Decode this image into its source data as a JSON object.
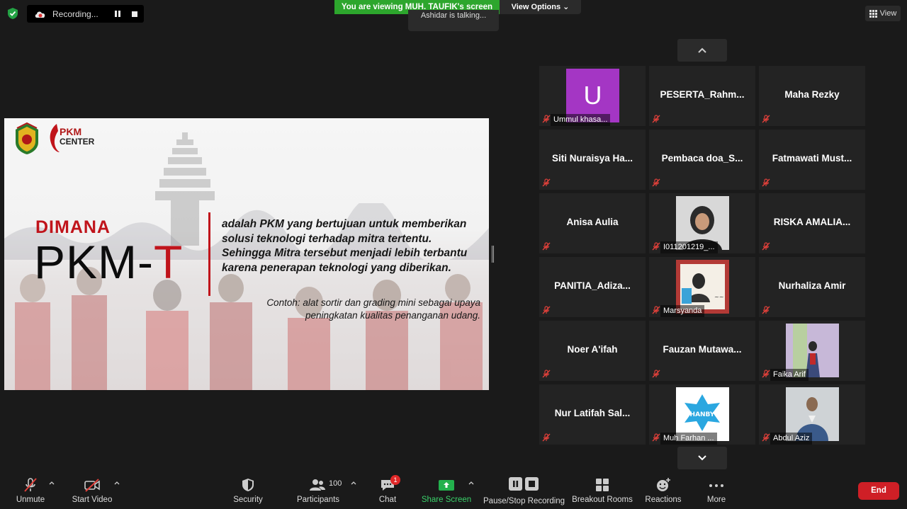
{
  "top": {
    "recording_label": "Recording...",
    "viewing_banner": "You are viewing MUH. TAUFIK's screen",
    "talking_indicator": "Ashidar is talking...",
    "view_options": "View Options",
    "view_button": "View"
  },
  "slide": {
    "dimana": "DIMANA",
    "pkm_t_main": "PKM-",
    "pkm_t_red": "T",
    "description": "adalah PKM yang bertujuan untuk memberikan solusi teknologi terhadap mitra tertentu. Sehingga Mitra tersebut menjadi lebih terbantu karena penerapan teknologi yang diberikan.",
    "example": "Contoh: alat sortir dan grading mini sebagai upaya peningkatan kualitas penanganan udang.",
    "logo_pkm_line1": "PKM",
    "logo_pkm_line2": "CENTER"
  },
  "participants": [
    {
      "name": "Ummul khasa...",
      "type": "avatar",
      "initial": "U"
    },
    {
      "name": "PESERTA_Rahm..."
    },
    {
      "name": "Maha Rezky"
    },
    {
      "name": "Siti Nuraisya Ha..."
    },
    {
      "name": "Pembaca doa_S..."
    },
    {
      "name": "Fatmawati Must..."
    },
    {
      "name": "Anisa Aulia"
    },
    {
      "name": "I011201219_...",
      "type": "photo"
    },
    {
      "name": "RISKA AMALIA..."
    },
    {
      "name": "PANITIA_Adiza..."
    },
    {
      "name": "Marsyanda",
      "type": "photo"
    },
    {
      "name": "Nurhaliza Amir"
    },
    {
      "name": "Noer A'ifah"
    },
    {
      "name": "Fauzan Mutawa..."
    },
    {
      "name": "Faika Arif",
      "type": "photo"
    },
    {
      "name": "Nur Latifah Sal..."
    },
    {
      "name": "Muh Farhan ...",
      "type": "photo"
    },
    {
      "name": "Abdul Aziz",
      "type": "photo"
    }
  ],
  "toolbar": {
    "unmute": "Unmute",
    "start_video": "Start Video",
    "security": "Security",
    "participants": "Participants",
    "participants_count": "100",
    "chat": "Chat",
    "chat_badge": "1",
    "share_screen": "Share Screen",
    "pause_stop_recording": "Pause/Stop Recording",
    "breakout_rooms": "Breakout Rooms",
    "reactions": "Reactions",
    "more": "More",
    "end": "End"
  },
  "colors": {
    "share_green": "#2da62d",
    "end_red": "#cf1f26",
    "avatar_purple": "#a436c4",
    "muted_red": "#e0403a"
  }
}
